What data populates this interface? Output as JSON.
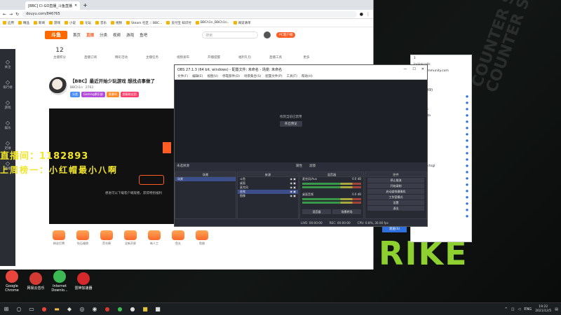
{
  "browser": {
    "tabs": [
      {
        "label": "[BBC] Cl-GO直播_斗鱼直播"
      }
    ],
    "url": "douyu.com/846765",
    "bookmarks": [
      "应用",
      "精品",
      "新闻",
      "游戏",
      "小说",
      "论坛",
      "音乐",
      "视频",
      "Steam 社区 :: BBC...",
      "支付宝 知识付",
      "BBCh1n_BBCh1n..",
      "阅读清单"
    ]
  },
  "site": {
    "logo": "斗鱼",
    "nav": [
      "首页",
      "直播",
      "分类",
      "视频",
      "游戏",
      "鱼吧"
    ],
    "search_placeholder": "搜索",
    "user_btn": "PC客户端",
    "icon_row": [
      {
        "num": "12",
        "label": "主播积分"
      },
      {
        "num": "",
        "label": "直播订阅"
      },
      {
        "num": "",
        "label": "精彩活动"
      },
      {
        "num": "",
        "label": "主播任务"
      },
      {
        "num": "",
        "label": "视频发布"
      },
      {
        "num": "",
        "label": "开播提醒"
      },
      {
        "num": "",
        "label": "福利礼包"
      },
      {
        "num": "",
        "label": "直播工具"
      },
      {
        "num": "",
        "label": "更多"
      }
    ],
    "sidebar": [
      "关注",
      "排行榜",
      "游戏",
      "娱乐",
      "足球",
      "直播"
    ],
    "room_title": "【BBC】最近开始少玩游戏 想找点事做了",
    "streamer": "BBCh1n",
    "hot": "2762",
    "badges": [
      "分类",
      "Gaming俱乐部",
      "直播间",
      "超级粉丝团"
    ],
    "overlay_line1": "直播间：1182893",
    "overlay_line2": "上周榜一：小红帽最小八啊",
    "video_hint": "想进可以下载客户端观看，获得特别福利",
    "gifts": [
      "粉丝灯牌",
      "钻石福袋",
      "荧光棒",
      "全新开屏",
      "新人工",
      "鱼丸",
      "鱼翅"
    ]
  },
  "obs": {
    "title": "OBS 27.1.3 (64 bit, windows) - 配置文件: 未命名 - 场景: 未命名",
    "menu": [
      "文件(F)",
      "编辑(E)",
      "视图(V)",
      "停靠部件(D)",
      "场景集合(S)",
      "配置文件(P)",
      "工具(T)",
      "帮助(H)"
    ],
    "no_source": "找到当前已禁用",
    "no_source_btn": "开启预览",
    "src_bar": [
      "未选择源",
      "属性",
      "滤镜"
    ],
    "panels": {
      "scenes": {
        "header": "场景",
        "items": [
          "场景"
        ]
      },
      "sources": {
        "header": "来源",
        "items": [
          "斗鱼",
          "桌面",
          "麦克风",
          "画笔",
          "图像"
        ]
      },
      "mixer": {
        "header": "混音器",
        "tracks": [
          {
            "name": "麦克风/Aux",
            "db": "0.0 dB"
          },
          {
            "name": "桌面音频",
            "db": "0.0 dB"
          }
        ],
        "tabs": [
          "混音器",
          "场景转场"
        ]
      },
      "controls": {
        "header": "控件",
        "buttons": [
          "停止推流",
          "开始录制",
          "启动虚拟摄像机",
          "工作室模式",
          "设置",
          "退出"
        ]
      }
    },
    "status": [
      "LIVE: 00:00:00",
      "REC: 00:00:00",
      "CPU: 0.8%, 30.00 fps"
    ]
  },
  "chat": {
    "lines": [
      "1",
      "loginkcalls",
      "steamcommunity.com",
      "...",
      "BBC0TE"
    ],
    "rank": "(183/499)",
    "users": [
      "Ch1n",
      "Bootnsor",
      "Loocheck",
      "Bluepanda",
      "JoyRosso",
      "taoVdbe",
      "Aitachi",
      "Fyosoro",
      "Kenstes",
      "Stiteiot",
      "Ichimary",
      "sufaln_mrtsgl",
      "zxf4sdl",
      "Sh_ya",
      "Rheinder",
      "Ventur",
      "Ginkrai",
      "Hjrrhtid",
      "Toeyan",
      "Aiden"
    ],
    "send_label": "发送(S)"
  },
  "desktop_icons": [
    {
      "label": "Google Chrome",
      "color": "#e8453c"
    },
    {
      "label": "网易云音乐",
      "color": "#d33a31"
    },
    {
      "label": "Internet Downlo...",
      "color": "#3cba54"
    },
    {
      "label": "雷神加速器",
      "color": "#d4282a"
    }
  ],
  "taskbar": {
    "tray_lang": "ENG",
    "time": "19:22",
    "date": "2021/12/5"
  }
}
